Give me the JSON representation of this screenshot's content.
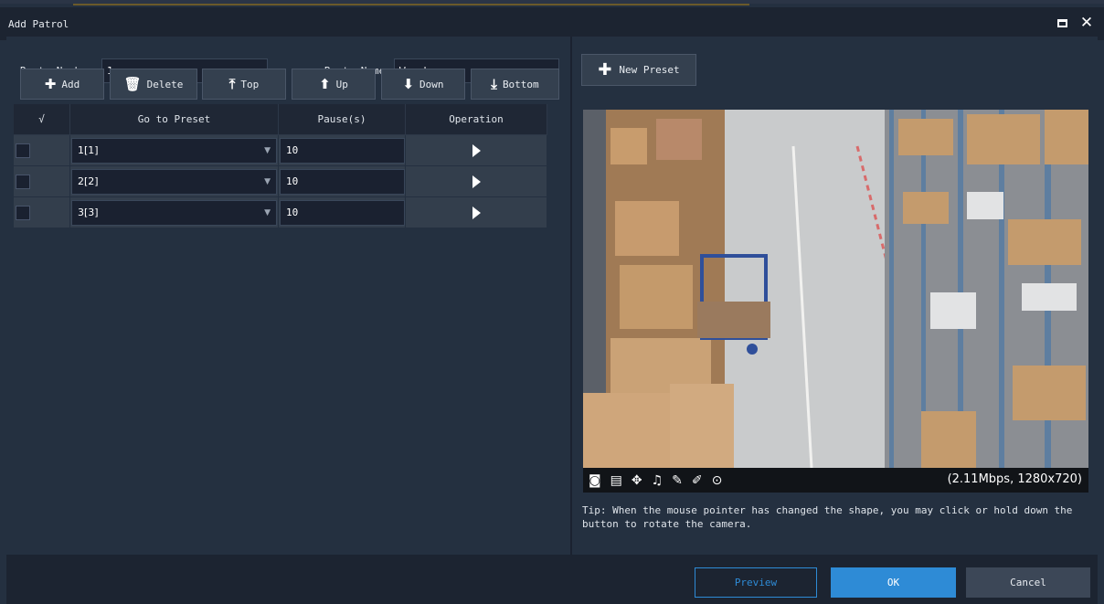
{
  "window": {
    "title": "Add Patrol",
    "maximize_icon": "maximize-icon",
    "close_icon": "close-icon"
  },
  "form": {
    "route_number_label": "Route Number",
    "route_number_value": "1",
    "route_name_label": "Route Name",
    "route_name_value": "Warehouse"
  },
  "toolbar": [
    {
      "label": "Add",
      "icon": "plus-icon"
    },
    {
      "label": "Delete",
      "icon": "trash-icon"
    },
    {
      "label": "Top",
      "icon": "move-top-icon"
    },
    {
      "label": "Up",
      "icon": "arrow-up-icon"
    },
    {
      "label": "Down",
      "icon": "arrow-down-icon"
    },
    {
      "label": "Bottom",
      "icon": "move-bottom-icon"
    }
  ],
  "grid": {
    "headers": [
      "√",
      "Go to Preset",
      "Pause(s)",
      "Operation"
    ],
    "rows": [
      {
        "preset": "1[1]",
        "pause": "10"
      },
      {
        "preset": "2[2]",
        "pause": "10"
      },
      {
        "preset": "3[3]",
        "pause": "10"
      }
    ]
  },
  "preview_panel": {
    "new_preset_label": "New Preset",
    "bitrate": "(2.11Mbps, 1280x720)",
    "tip": "Tip: When the mouse pointer has changed the shape, you may click or hold down the button to rotate the camera."
  },
  "footer": {
    "preview_label": "Preview",
    "ok_label": "OK",
    "cancel_label": "Cancel"
  },
  "colors": {
    "accent": "#2e8bd6",
    "background": "#243040",
    "titlebar": "#1c2431"
  }
}
